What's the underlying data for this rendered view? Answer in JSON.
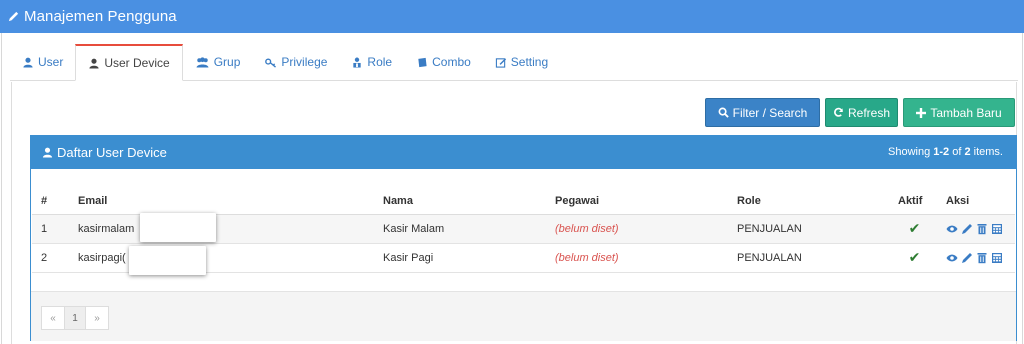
{
  "app": {
    "title": "Manajemen Pengguna"
  },
  "tabs": [
    {
      "label": "User"
    },
    {
      "label": "User Device"
    },
    {
      "label": "Grup"
    },
    {
      "label": "Privilege"
    },
    {
      "label": "Role"
    },
    {
      "label": "Combo"
    },
    {
      "label": "Setting"
    }
  ],
  "toolbar": {
    "filter": "Filter / Search",
    "refresh": "Refresh",
    "add": "Tambah Baru"
  },
  "list": {
    "title": "Daftar User Device",
    "summary_prefix": "Showing ",
    "summary_range": "1-2",
    "summary_mid": " of ",
    "summary_total": "2",
    "summary_suffix": " items."
  },
  "table": {
    "headers": [
      "#",
      "Email",
      "Nama",
      "Pegawai",
      "Role",
      "Aktif",
      "Aksi"
    ],
    "rows": [
      {
        "no": "1",
        "email": "kasirmalam",
        "nama": "Kasir Malam",
        "pegawai": "(belum diset)",
        "role": "PENJUALAN",
        "aktif": "✔"
      },
      {
        "no": "2",
        "email": "kasirpagi(",
        "nama": "Kasir Pagi",
        "pegawai": "(belum diset)",
        "role": "PENJUALAN",
        "aktif": "✔"
      }
    ]
  },
  "pager": {
    "prev": "«",
    "page": "1",
    "next": "»"
  },
  "colors": {
    "header": "#4a90e2",
    "panel": "#3b8ed0",
    "filter": "#3b83c7",
    "refresh": "#28a889",
    "add": "#34b48e",
    "active_tab_top": "#e74c3c"
  },
  "icons": [
    "pencil-icon",
    "user-icon",
    "group-icon",
    "key-icon",
    "role-icon",
    "book-icon",
    "edit-icon",
    "search-icon",
    "refresh-icon",
    "plus-icon",
    "eye-icon",
    "trash-icon",
    "calculator-icon",
    "check-icon"
  ]
}
